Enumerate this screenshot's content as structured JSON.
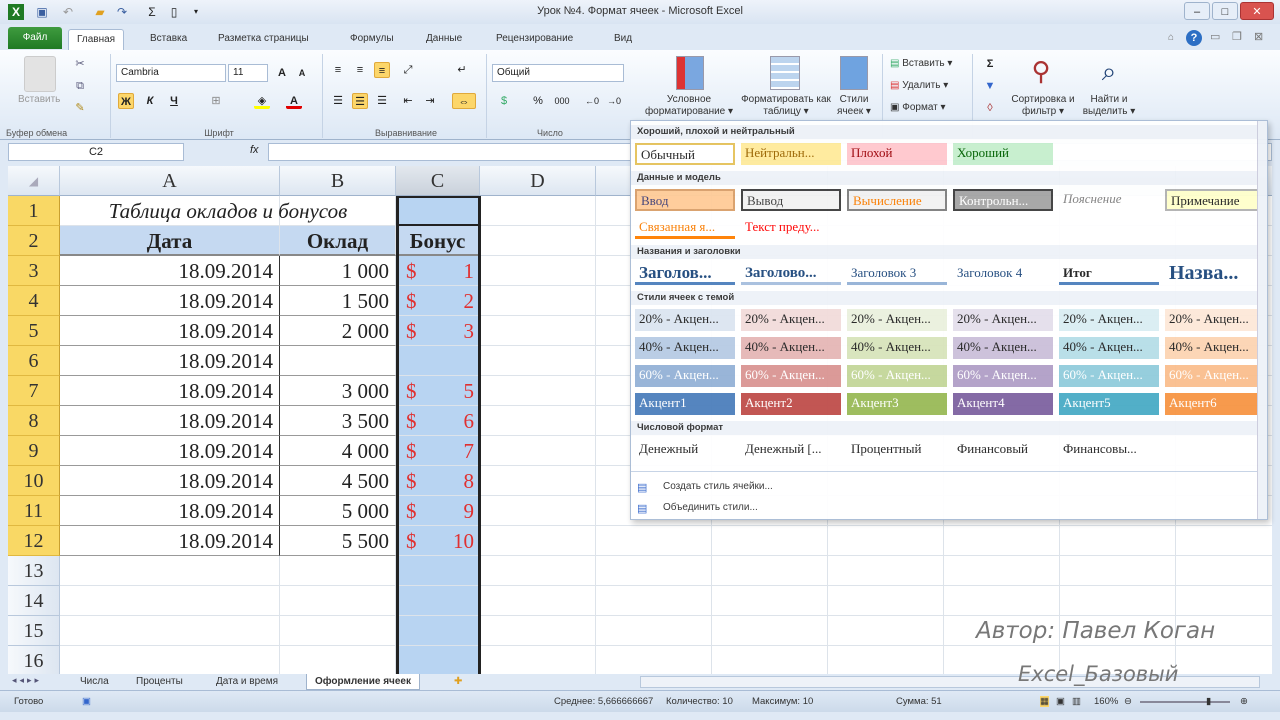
{
  "window": {
    "title": "Урок №4. Формат ячеек - Microsoft Excel",
    "quick_access": [
      "excel-icon",
      "save-icon",
      "undo-icon",
      "open-icon",
      "redo-icon",
      "sum-icon",
      "new-icon",
      "customize-icon"
    ]
  },
  "tabs": {
    "file": "Файл",
    "items": [
      "Главная",
      "Вставка",
      "Разметка страницы",
      "Формулы",
      "Данные",
      "Рецензирование",
      "Вид"
    ]
  },
  "ribbon": {
    "clipboard": {
      "paste": "Вставить",
      "label": "Буфер обмена"
    },
    "font": {
      "name": "Cambria",
      "size": "11",
      "label": "Шрифт",
      "bold": "Ж",
      "italic": "К",
      "underline": "Ч"
    },
    "alignment": {
      "label": "Выравнивание"
    },
    "number": {
      "format": "Общий",
      "label": "Число",
      "percent": "%",
      "thousands": "000"
    },
    "styles": {
      "conditional": "Условное форматирование ▾",
      "as_table": "Форматировать как таблицу ▾",
      "cell_styles": "Стили ячеек ▾"
    },
    "cells": {
      "insert": "Вставить ▾",
      "delete": "Удалить ▾",
      "format": "Формат ▾"
    },
    "editing": {
      "sort": "Сортировка и фильтр ▾",
      "find": "Найти и выделить ▾"
    }
  },
  "formula_bar": {
    "name_box": "C2",
    "fx": "fx",
    "value": ""
  },
  "sheet": {
    "columns": [
      "A",
      "B",
      "C",
      "D"
    ],
    "title": "Таблица окладов и бонусов",
    "headers": [
      "Дата",
      "Оклад",
      "Бонус"
    ],
    "rows": [
      [
        "18.09.2014",
        "1 000",
        "$",
        "1"
      ],
      [
        "18.09.2014",
        "1 500",
        "$",
        "2"
      ],
      [
        "18.09.2014",
        "2 000",
        "$",
        "3"
      ],
      [
        "18.09.2014",
        "",
        "",
        ""
      ],
      [
        "18.09.2014",
        "3 000",
        "$",
        "5"
      ],
      [
        "18.09.2014",
        "3 500",
        "$",
        "6"
      ],
      [
        "18.09.2014",
        "4 000",
        "$",
        "7"
      ],
      [
        "18.09.2014",
        "4 500",
        "$",
        "8"
      ],
      [
        "18.09.2014",
        "5 000",
        "$",
        "9"
      ],
      [
        "18.09.2014",
        "5 500",
        "$",
        "10"
      ]
    ],
    "row_numbers": [
      "1",
      "2",
      "3",
      "4",
      "5",
      "6",
      "7",
      "8",
      "9",
      "10",
      "11",
      "12",
      "13",
      "14",
      "15",
      "16"
    ]
  },
  "gallery": {
    "sections": [
      {
        "title": "Хороший, плохой и нейтральный",
        "rows": [
          [
            {
              "t": "Обычный",
              "bg": "#ffffff",
              "fg": "#222",
              "bd": "#e6c35c"
            },
            {
              "t": "Нейтральн...",
              "bg": "#ffeb9c",
              "fg": "#9c6500"
            },
            {
              "t": "Плохой",
              "bg": "#ffc7ce",
              "fg": "#9c0006"
            },
            {
              "t": "Хороший",
              "bg": "#c6efce",
              "fg": "#006100"
            }
          ]
        ]
      },
      {
        "title": "Данные и модель",
        "rows": [
          [
            {
              "t": "Ввод",
              "bg": "#ffcc99",
              "fg": "#3f3f76",
              "bd": "#d9a06b"
            },
            {
              "t": "Вывод",
              "bg": "#f2f2f2",
              "fg": "#3f3f3f",
              "bd": "#3f3f3f"
            },
            {
              "t": "Вычисление",
              "bg": "#f2f2f2",
              "fg": "#fa7d00",
              "bd": "#7f7f7f"
            },
            {
              "t": "Контрольн...",
              "bg": "#a5a5a5",
              "fg": "#ffffff",
              "bd": "#3f3f3f"
            },
            {
              "t": "Пояснение",
              "bg": "#ffffff",
              "fg": "#7f7f7f",
              "it": true
            },
            {
              "t": "Примечание",
              "bg": "#ffffcc",
              "fg": "#222",
              "bd": "#b2b2b2"
            }
          ],
          [
            {
              "t": "Связанная я...",
              "bg": "#ffffff",
              "fg": "#fa7d00",
              "ul": "#ff8001"
            },
            {
              "t": "Текст преду...",
              "bg": "#ffffff",
              "fg": "#ff0000"
            }
          ]
        ]
      },
      {
        "title": "Названия и заголовки",
        "rows": [
          [
            {
              "t": "Заголов...",
              "bg": "#fff",
              "fg": "#1f497d",
              "ul": "#4f81bd",
              "big": 17
            },
            {
              "t": "Заголово...",
              "bg": "#fff",
              "fg": "#1f497d",
              "ul": "#a7bfde",
              "big": 15
            },
            {
              "t": "Заголовок 3",
              "bg": "#fff",
              "fg": "#1f497d",
              "ul": "#95b3d7"
            },
            {
              "t": "Заголовок 4",
              "bg": "#fff",
              "fg": "#1f497d"
            },
            {
              "t": "Итог",
              "bg": "#fff",
              "fg": "#222",
              "ul": "#4f81bd",
              "b": true
            },
            {
              "t": "Назва...",
              "bg": "#fff",
              "fg": "#1f497d",
              "big": 20
            }
          ]
        ]
      },
      {
        "title": "Стили ячеек с темой",
        "rows": [
          [
            {
              "t": "20% - Акцен...",
              "bg": "#dce6f1"
            },
            {
              "t": "20% - Акцен...",
              "bg": "#f2dcdb"
            },
            {
              "t": "20% - Акцен...",
              "bg": "#ebf1de"
            },
            {
              "t": "20% - Акцен...",
              "bg": "#e4dfec"
            },
            {
              "t": "20% - Акцен...",
              "bg": "#daeef3"
            },
            {
              "t": "20% - Акцен...",
              "bg": "#fde9d9"
            }
          ],
          [
            {
              "t": "40% - Акцен...",
              "bg": "#b8cce4"
            },
            {
              "t": "40% - Акцен...",
              "bg": "#e6b8b7"
            },
            {
              "t": "40% - Акцен...",
              "bg": "#d8e4bc"
            },
            {
              "t": "40% - Акцен...",
              "bg": "#ccc0da"
            },
            {
              "t": "40% - Акцен...",
              "bg": "#b7dee8"
            },
            {
              "t": "40% - Акцен...",
              "bg": "#fcd5b4"
            }
          ],
          [
            {
              "t": "60% - Акцен...",
              "bg": "#95b3d7",
              "fg": "#fff"
            },
            {
              "t": "60% - Акцен...",
              "bg": "#da9694",
              "fg": "#fff"
            },
            {
              "t": "60% - Акцен...",
              "bg": "#c4d79b",
              "fg": "#fff"
            },
            {
              "t": "60% - Акцен...",
              "bg": "#b1a0c7",
              "fg": "#fff"
            },
            {
              "t": "60% - Акцен...",
              "bg": "#92cddc",
              "fg": "#fff"
            },
            {
              "t": "60% - Акцен...",
              "bg": "#fabf8f",
              "fg": "#fff"
            }
          ],
          [
            {
              "t": "Акцент1",
              "bg": "#4f81bd",
              "fg": "#fff"
            },
            {
              "t": "Акцент2",
              "bg": "#c0504d",
              "fg": "#fff"
            },
            {
              "t": "Акцент3",
              "bg": "#9bbb59",
              "fg": "#fff"
            },
            {
              "t": "Акцент4",
              "bg": "#8064a2",
              "fg": "#fff"
            },
            {
              "t": "Акцент5",
              "bg": "#4bacc6",
              "fg": "#fff"
            },
            {
              "t": "Акцент6",
              "bg": "#f79646",
              "fg": "#fff"
            }
          ]
        ]
      },
      {
        "title": "Числовой формат",
        "rows": [
          [
            {
              "t": "Денежный",
              "bg": "#fff"
            },
            {
              "t": "Денежный [...",
              "bg": "#fff"
            },
            {
              "t": "Процентный",
              "bg": "#fff"
            },
            {
              "t": "Финансовый",
              "bg": "#fff"
            },
            {
              "t": "Финансовы...",
              "bg": "#fff"
            }
          ]
        ]
      }
    ],
    "menu": [
      "Создать стиль ячейки...",
      "Объединить стили..."
    ]
  },
  "sheet_tabs": [
    "Числа",
    "Проценты",
    "Дата и время",
    "Оформление ячеек"
  ],
  "status": {
    "ready": "Готово",
    "average": "Среднее: 5,666666667",
    "count": "Количество: 10",
    "max": "Максимум: 10",
    "sum": "Сумма: 51",
    "zoom": "160%"
  },
  "watermark": {
    "author": "Автор: Павел Коган",
    "course": "Excel_Базовый"
  }
}
